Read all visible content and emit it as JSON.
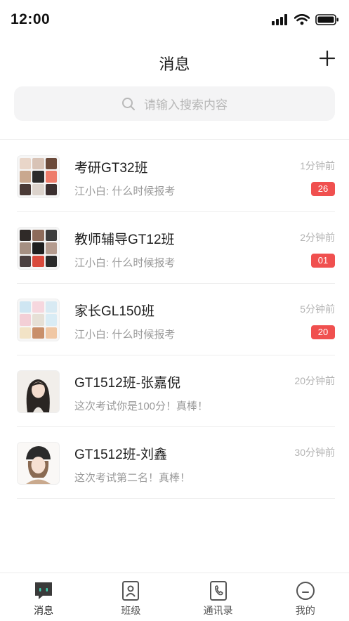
{
  "status_bar": {
    "time": "12:00"
  },
  "header": {
    "title": "消息"
  },
  "search": {
    "placeholder": "请输入搜索内容"
  },
  "conversations": [
    {
      "name": "考研GT32班",
      "preview": "江小白: 什么时候报考",
      "time": "1分钟前",
      "unread": "26",
      "avatar": "group"
    },
    {
      "name": "教师辅导GT12班",
      "preview": "江小白: 什么时候报考",
      "time": "2分钟前",
      "unread": "01",
      "avatar": "group"
    },
    {
      "name": "家长GL150班",
      "preview": "江小白: 什么时候报考",
      "time": "5分钟前",
      "unread": "20",
      "avatar": "group"
    },
    {
      "name": "GT1512班-张嘉倪",
      "preview": "这次考试你是100分！真棒！",
      "time": "20分钟前",
      "avatar": "person"
    },
    {
      "name": "GT1512班-刘鑫",
      "preview": "这次考试第二名！真棒！",
      "time": "30分钟前",
      "avatar": "person"
    }
  ],
  "tabs": [
    {
      "label": "消息",
      "icon": "chat-icon",
      "active": true
    },
    {
      "label": "班级",
      "icon": "class-icon"
    },
    {
      "label": "通讯录",
      "icon": "phone-book-icon"
    },
    {
      "label": "我的",
      "icon": "profile-icon"
    }
  ],
  "colors": {
    "badge": "#f0504f",
    "accent": "#3a3a3a"
  }
}
